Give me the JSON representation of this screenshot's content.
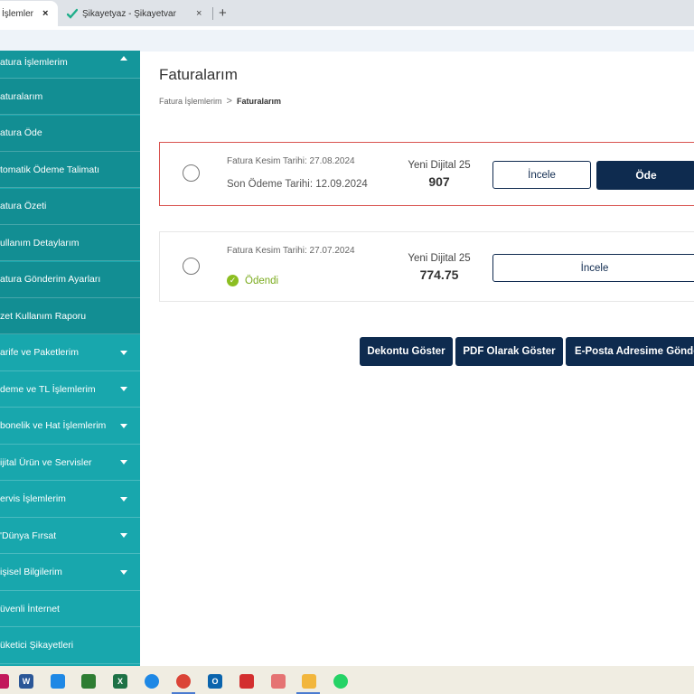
{
  "browser": {
    "tabs": [
      {
        "label": "İşlemler",
        "close": "×",
        "active": true
      },
      {
        "label": "Şikayetyaz - Şikayetvar",
        "close": "×",
        "active": false
      }
    ],
    "new_tab": "+"
  },
  "sidebar": {
    "header": "atura İşlemlerim",
    "items": [
      {
        "label": "aturalarım",
        "has_caret": false,
        "sub": true
      },
      {
        "label": "atura Öde",
        "has_caret": false,
        "sub": true
      },
      {
        "label": "tomatik Ödeme Talimatı",
        "has_caret": false,
        "sub": true
      },
      {
        "label": "atura Özeti",
        "has_caret": false,
        "sub": true
      },
      {
        "label": "ullanım Detaylarım",
        "has_caret": false,
        "sub": true
      },
      {
        "label": "atura Gönderim Ayarları",
        "has_caret": false,
        "sub": true
      },
      {
        "label": "zet Kullanım Raporu",
        "has_caret": false,
        "sub": true
      },
      {
        "label": "arife ve Paketlerim",
        "has_caret": true,
        "sub": false
      },
      {
        "label": "deme ve TL İşlemlerim",
        "has_caret": true,
        "sub": false
      },
      {
        "label": "bonelik ve Hat İşlemlerim",
        "has_caret": true,
        "sub": false
      },
      {
        "label": "ijital Ürün ve Servisler",
        "has_caret": true,
        "sub": false
      },
      {
        "label": "ervis İşlemlerim",
        "has_caret": true,
        "sub": false
      },
      {
        "label": "'Dünya Fırsat",
        "has_caret": true,
        "sub": false
      },
      {
        "label": "işisel Bilgilerim",
        "has_caret": true,
        "sub": false
      },
      {
        "label": "üvenli İnternet",
        "has_caret": false,
        "sub": false
      },
      {
        "label": "üketici Şikayetleri",
        "has_caret": false,
        "sub": false
      }
    ]
  },
  "main": {
    "title": "Faturalarım",
    "breadcrumb": {
      "parent": "Fatura İşlemlerim",
      "separator": ">",
      "current": "Faturalarım"
    },
    "invoices": [
      {
        "issue_date": "Fatura Kesim Tarihi: 27.08.2024",
        "due_date": "Son Ödeme Tarihi: 12.09.2024",
        "plan": "Yeni Dijital 25",
        "amount": "907",
        "inspect_label": "İncele",
        "pay_label": "Öde"
      },
      {
        "issue_date": "Fatura Kesim Tarihi: 27.07.2024",
        "status": "Ödendi",
        "plan": "Yeni Dijital 25",
        "amount": "774.75",
        "inspect_label": "İncele"
      }
    ],
    "actions": {
      "receipt": "Dekontu Göster",
      "pdf": "PDF Olarak Göster",
      "email": "E-Posta Adresime Gönder"
    }
  },
  "colors": {
    "sidebar": "#18a7ad",
    "primary_dark": "#0e2b4f",
    "due_border": "#d9534f",
    "paid_green": "#8cbe21"
  },
  "taskbar": {
    "icons": [
      "gem-icon",
      "word-icon",
      "calendar-icon",
      "diamond-icon",
      "excel-icon",
      "edge-icon",
      "chrome-icon",
      "outlook-icon",
      "pdf-icon",
      "paint-icon",
      "folder-icon",
      "whatsapp-icon"
    ]
  }
}
